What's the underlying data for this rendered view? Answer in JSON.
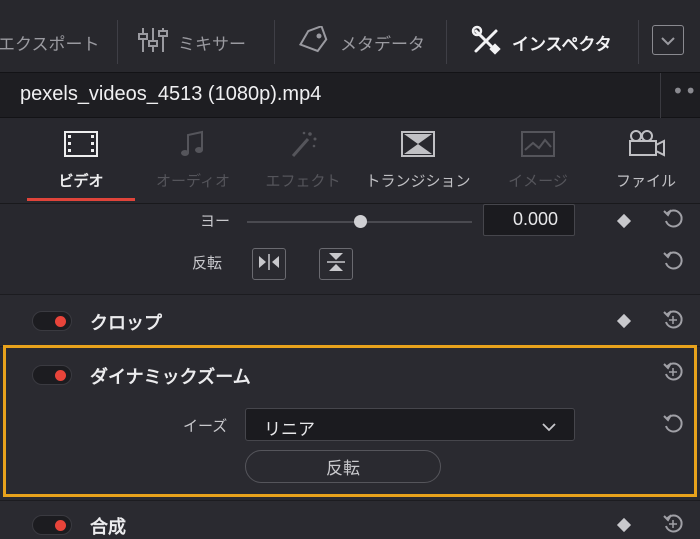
{
  "toolbar": {
    "items": [
      {
        "label": "エクスポート",
        "icon": "export-icon"
      },
      {
        "label": "ミキサー",
        "icon": "mixer-icon"
      },
      {
        "label": "メタデータ",
        "icon": "metadata-tag-icon"
      },
      {
        "label": "インスペクタ",
        "icon": "inspector-tools-icon"
      }
    ],
    "collapse_icon": "chevron-down-icon"
  },
  "clip": {
    "name": "pexels_videos_4513 (1080p).mp4",
    "more_icon": "more-dots-icon"
  },
  "tabs": [
    {
      "label": "ビデオ",
      "icon": "film-icon",
      "active": true
    },
    {
      "label": "オーディオ",
      "icon": "music-note-icon",
      "active": false
    },
    {
      "label": "エフェクト",
      "icon": "magic-wand-icon",
      "active": false
    },
    {
      "label": "トランジション",
      "icon": "transition-icon",
      "active": false
    },
    {
      "label": "イメージ",
      "icon": "image-icon",
      "active": false
    },
    {
      "label": "ファイル",
      "icon": "camera-icon",
      "active": false
    }
  ],
  "transform": {
    "yaw_label": "ヨー",
    "yaw_value": "0.000",
    "yaw_slider_fraction": 0.5,
    "flip_label": "反転"
  },
  "sections": {
    "crop": {
      "title": "クロップ",
      "enabled": true
    },
    "dynamic_zoom": {
      "title": "ダイナミックズーム",
      "enabled": true,
      "ease_label": "イーズ",
      "ease_value": "リニア",
      "flip_button": "反転"
    },
    "composite": {
      "title": "合成",
      "enabled": true
    }
  },
  "colors": {
    "accent_red": "#e8443a",
    "highlight_orange": "#e8a21c"
  }
}
